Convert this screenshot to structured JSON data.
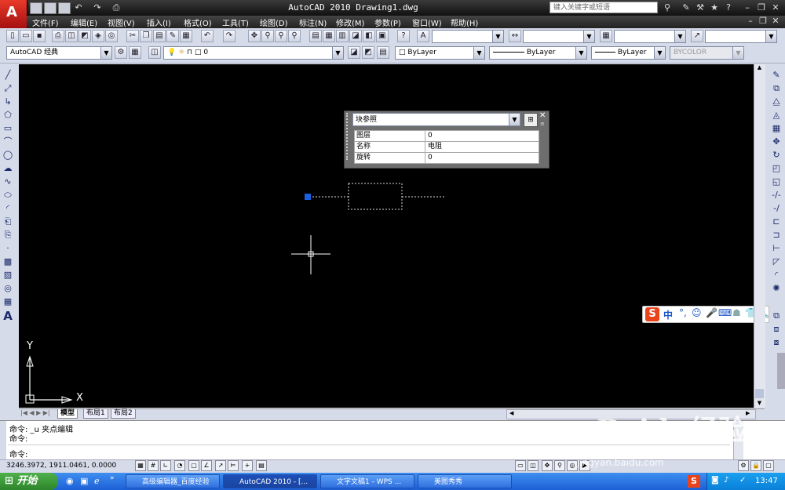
{
  "titlebar": {
    "app_icon_letter": "A",
    "title": "AutoCAD 2010   Drawing1.dwg",
    "search_placeholder": "键入关键字或短语",
    "quick_access_icons": [
      "new-file-icon",
      "open-icon",
      "save-icon",
      "undo-icon",
      "redo-icon",
      "plot-icon"
    ]
  },
  "menu": {
    "items": [
      "文件(F)",
      "编辑(E)",
      "视图(V)",
      "插入(I)",
      "格式(O)",
      "工具(T)",
      "绘图(D)",
      "标注(N)",
      "修改(M)",
      "参数(P)",
      "窗口(W)",
      "帮助(H)"
    ]
  },
  "toolbar_props": {
    "workspace": "AutoCAD 经典",
    "layer": "0",
    "color": "ByLayer",
    "linetype": "ByLayer",
    "lineweight": "ByLayer",
    "plotstyle": "BYCOLOR"
  },
  "quick_properties": {
    "object_type": "块参照",
    "rows": [
      {
        "key": "图层",
        "value": "0"
      },
      {
        "key": "名称",
        "value": "电阻"
      },
      {
        "key": "旋转",
        "value": "0"
      }
    ]
  },
  "canvas": {
    "ucs_x": "X",
    "ucs_y": "Y"
  },
  "layout_tabs": [
    "模型",
    "布局1",
    "布局2"
  ],
  "command": {
    "line1": "命令: _u 夹点编辑",
    "line2": "命令:",
    "prompt": "命令:"
  },
  "status": {
    "coords": "3246.3972, 1911.0461, 0.0000"
  },
  "ime": {
    "logo": "S",
    "mode": "中"
  },
  "taskbar": {
    "start": "开始",
    "tasks": [
      "高级编辑器_百度经验",
      "AutoCAD 2010 - [...",
      "文字文稿1 - WPS ...",
      "美图秀秀"
    ],
    "clock": "13:47"
  },
  "watermark": {
    "brand": "Baidu经验",
    "url": "jingyan.baidu.com"
  }
}
